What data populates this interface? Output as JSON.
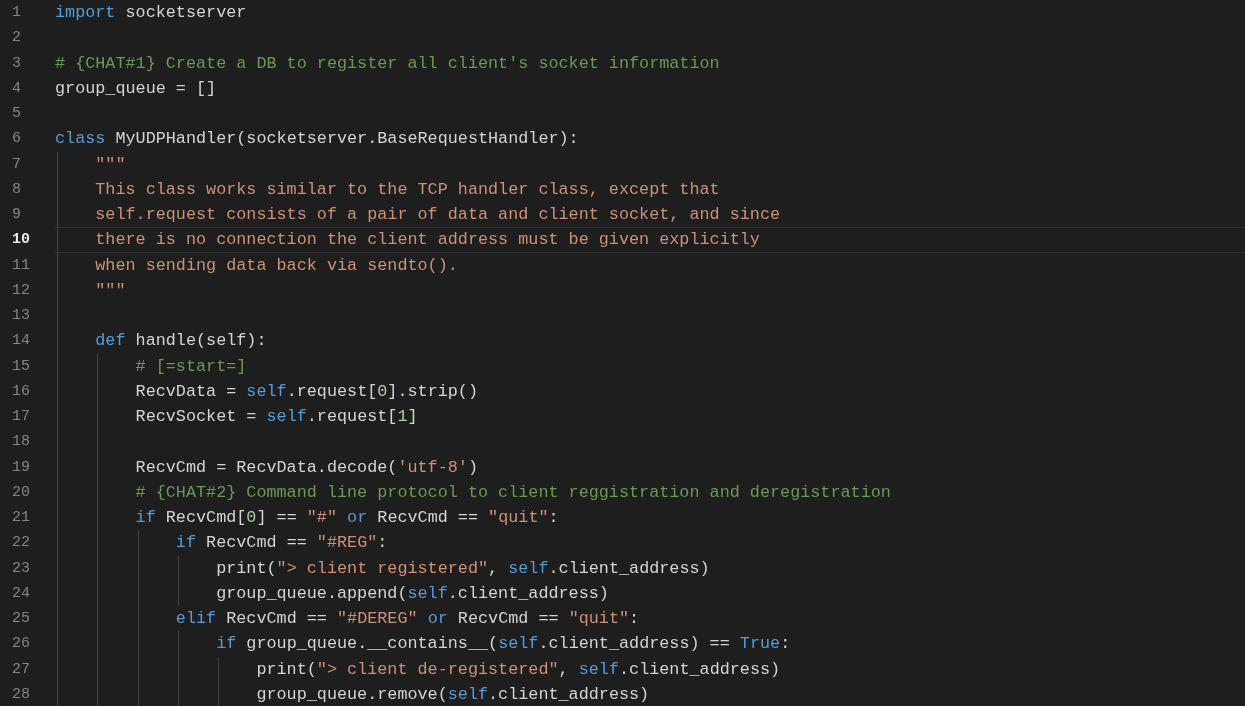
{
  "editor": {
    "lines": [
      {
        "number": "1",
        "selected": false,
        "tokens": [
          {
            "kind": "keyword",
            "text": "import"
          },
          {
            "kind": "plain",
            "text": " socketserver"
          }
        ]
      },
      {
        "number": "2",
        "selected": false
      },
      {
        "number": "3",
        "selected": false,
        "tokens": [
          {
            "kind": "comment",
            "text": "# {CHAT#1} Create a DB to register all client's socket information"
          }
        ]
      },
      {
        "number": "4",
        "selected": false,
        "tokens": [
          {
            "kind": "plain",
            "text": "group_queue = []"
          }
        ]
      },
      {
        "number": "5",
        "selected": false
      },
      {
        "number": "6",
        "selected": false,
        "tokens": [
          {
            "kind": "keyword",
            "text": "class"
          },
          {
            "kind": "plain",
            "text": " MyUDPHandler(socketserver.BaseRequestHandler):"
          }
        ]
      },
      {
        "number": "7",
        "selected": false,
        "tokens": [
          {
            "kind": "string",
            "text": "    \"\"\""
          }
        ]
      },
      {
        "number": "8",
        "selected": false,
        "tokens": [
          {
            "kind": "string",
            "text": "    This class works similar to the TCP handler class, except that"
          }
        ]
      },
      {
        "number": "9",
        "selected": false,
        "tokens": [
          {
            "kind": "string",
            "text": "    self.request consists of a pair of data and client socket, and since"
          }
        ]
      },
      {
        "number": "10",
        "selected": true,
        "tokens": [
          {
            "kind": "string",
            "text": "    there is no connection the client address must be given explicitly"
          }
        ]
      },
      {
        "number": "11",
        "selected": false,
        "tokens": [
          {
            "kind": "string",
            "text": "    when sending data back via sendto()."
          }
        ]
      },
      {
        "number": "12",
        "selected": false,
        "tokens": [
          {
            "kind": "string",
            "text": "    \"\"\""
          }
        ]
      },
      {
        "number": "13",
        "selected": false
      },
      {
        "number": "14",
        "selected": false,
        "tokens": [
          {
            "kind": "keyword",
            "text": "    def"
          },
          {
            "kind": "plain",
            "text": " handle(self):"
          }
        ]
      },
      {
        "number": "15",
        "selected": false,
        "tokens": [
          {
            "kind": "comment",
            "text": "        # [=start=]"
          }
        ]
      },
      {
        "number": "16",
        "selected": false,
        "tokens": [
          {
            "kind": "plain",
            "text": "        RecvData = "
          },
          {
            "kind": "keyword",
            "text": "self"
          },
          {
            "kind": "plain",
            "text": ".request["
          },
          {
            "kind": "number",
            "text": "0"
          },
          {
            "kind": "plain",
            "text": "].strip()"
          }
        ]
      },
      {
        "number": "17",
        "selected": false,
        "tokens": [
          {
            "kind": "plain",
            "text": "        RecvSocket = "
          },
          {
            "kind": "keyword",
            "text": "self"
          },
          {
            "kind": "plain",
            "text": ".request["
          },
          {
            "kind": "number",
            "text": "1"
          },
          {
            "kind": "plain",
            "text": "]"
          }
        ]
      },
      {
        "number": "18",
        "selected": false
      },
      {
        "number": "19",
        "selected": false,
        "tokens": [
          {
            "kind": "plain",
            "text": "        RecvCmd = RecvData.decode("
          },
          {
            "kind": "string",
            "text": "'utf-8'"
          },
          {
            "kind": "plain",
            "text": ")"
          }
        ]
      },
      {
        "number": "20",
        "selected": false,
        "tokens": [
          {
            "kind": "comment",
            "text": "        # {CHAT#2} Command line protocol to client reggistration and deregistration"
          }
        ]
      },
      {
        "number": "21",
        "selected": false,
        "tokens": [
          {
            "kind": "keyword",
            "text": "        if"
          },
          {
            "kind": "plain",
            "text": " RecvCmd["
          },
          {
            "kind": "number",
            "text": "0"
          },
          {
            "kind": "plain",
            "text": "] == "
          },
          {
            "kind": "string",
            "text": "\"#\""
          },
          {
            "kind": "keyword",
            "text": " or"
          },
          {
            "kind": "plain",
            "text": " RecvCmd == "
          },
          {
            "kind": "string",
            "text": "\"quit\""
          },
          {
            "kind": "plain",
            "text": ":"
          }
        ]
      },
      {
        "number": "22",
        "selected": false,
        "tokens": [
          {
            "kind": "keyword",
            "text": "            if"
          },
          {
            "kind": "plain",
            "text": " RecvCmd == "
          },
          {
            "kind": "string",
            "text": "\"#REG\""
          },
          {
            "kind": "plain",
            "text": ":"
          }
        ]
      },
      {
        "number": "23",
        "selected": false,
        "tokens": [
          {
            "kind": "plain",
            "text": "                print("
          },
          {
            "kind": "string",
            "text": "\"> client registered\""
          },
          {
            "kind": "plain",
            "text": ", "
          },
          {
            "kind": "keyword",
            "text": "self"
          },
          {
            "kind": "plain",
            "text": ".client_address)"
          }
        ]
      },
      {
        "number": "24",
        "selected": false,
        "tokens": [
          {
            "kind": "plain",
            "text": "                group_queue.append("
          },
          {
            "kind": "keyword",
            "text": "self"
          },
          {
            "kind": "plain",
            "text": ".client_address)"
          }
        ]
      },
      {
        "number": "25",
        "selected": false,
        "tokens": [
          {
            "kind": "keyword",
            "text": "            elif"
          },
          {
            "kind": "plain",
            "text": " RecvCmd == "
          },
          {
            "kind": "string",
            "text": "\"#DEREG\""
          },
          {
            "kind": "keyword",
            "text": " or"
          },
          {
            "kind": "plain",
            "text": " RecvCmd == "
          },
          {
            "kind": "string",
            "text": "\"quit\""
          },
          {
            "kind": "plain",
            "text": ":"
          }
        ]
      },
      {
        "number": "26",
        "selected": false,
        "tokens": [
          {
            "kind": "keyword",
            "text": "                if"
          },
          {
            "kind": "plain",
            "text": " group_queue.__contains__("
          },
          {
            "kind": "keyword",
            "text": "self"
          },
          {
            "kind": "plain",
            "text": ".client_address) == "
          },
          {
            "kind": "keyword",
            "text": "True"
          },
          {
            "kind": "plain",
            "text": ":"
          }
        ]
      },
      {
        "number": "27",
        "selected": false,
        "tokens": [
          {
            "kind": "plain",
            "text": "                    print("
          },
          {
            "kind": "string",
            "text": "\"> client de-registered\""
          },
          {
            "kind": "plain",
            "text": ", "
          },
          {
            "kind": "keyword",
            "text": "self"
          },
          {
            "kind": "plain",
            "text": ".client_address)"
          }
        ]
      },
      {
        "number": "28",
        "selected": false,
        "tokens": [
          {
            "kind": "plain",
            "text": "                    group_queue.remove("
          },
          {
            "kind": "keyword",
            "text": "self"
          },
          {
            "kind": "plain",
            "text": ".client_address)"
          }
        ]
      }
    ]
  }
}
